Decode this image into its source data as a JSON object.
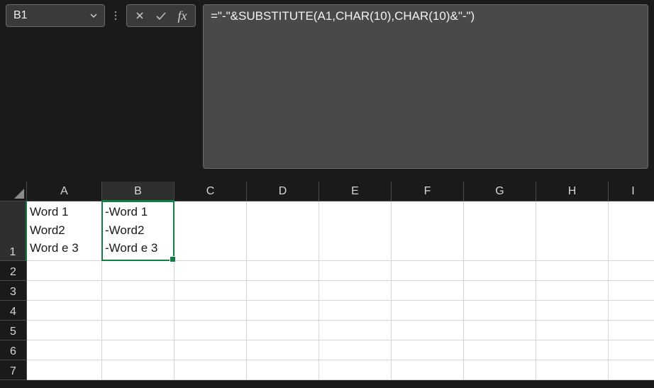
{
  "namebox": {
    "value": "B1"
  },
  "formula_bar": {
    "cancel_icon": "cancel-icon",
    "enter_icon": "enter-icon",
    "fx_label": "fx",
    "value": "=\"-\"&SUBSTITUTE(A1,CHAR(10),CHAR(10)&\"-\")"
  },
  "columns": [
    "A",
    "B",
    "C",
    "D",
    "E",
    "F",
    "G",
    "H",
    "I"
  ],
  "rows": [
    "1",
    "2",
    "3",
    "4",
    "5",
    "6",
    "7"
  ],
  "selected_column": "B",
  "selected_row": "1",
  "cells": {
    "A1": "Word 1\nWord2\nWord e 3",
    "B1": "-Word 1\n-Word2\n-Word e 3"
  },
  "colors": {
    "accent": "#137e43",
    "panel": "#494949",
    "dark": "#1a1a1a"
  }
}
